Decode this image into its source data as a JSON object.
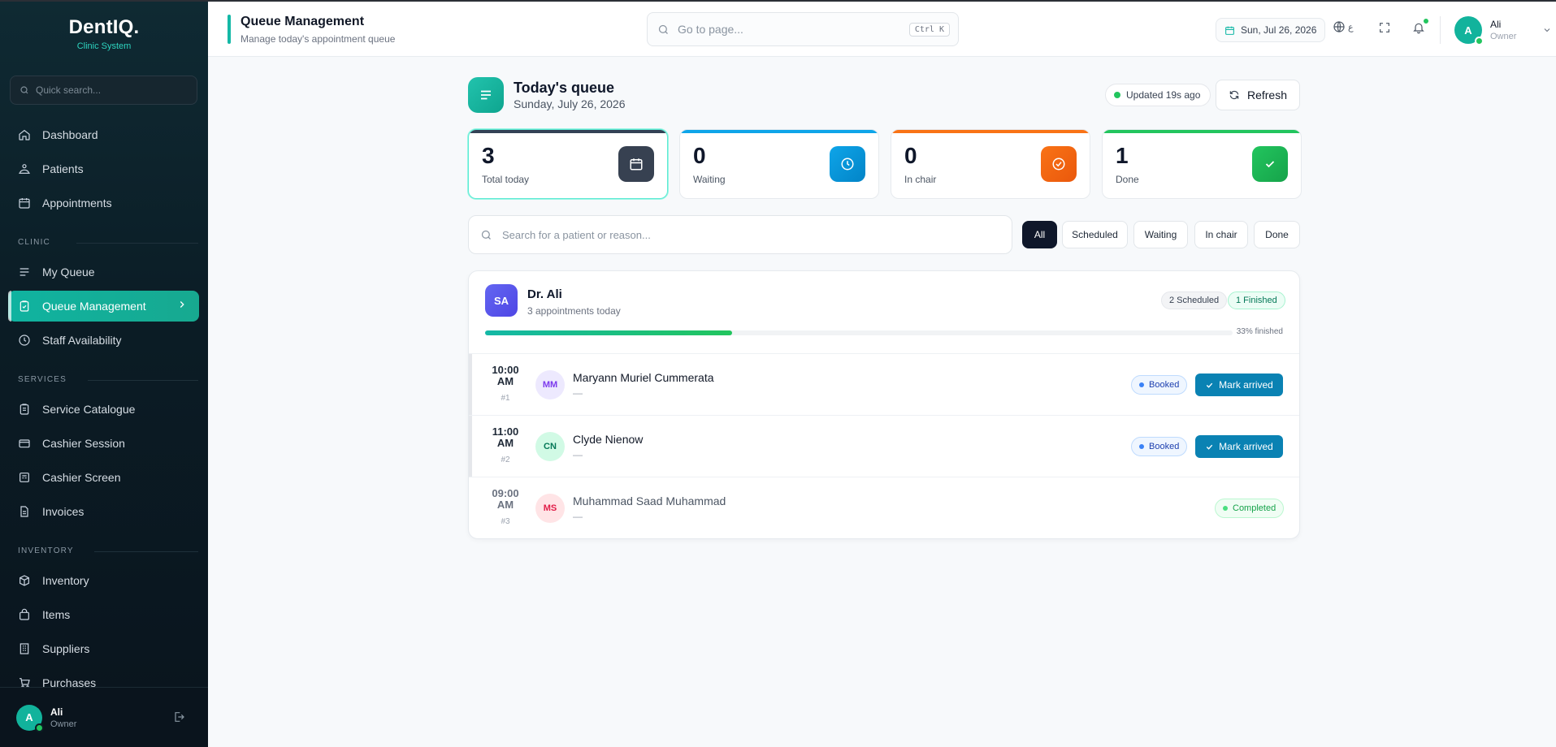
{
  "brand": {
    "name": "DentIQ.",
    "subtitle": "Clinic System"
  },
  "sidebar": {
    "search_placeholder": "Quick search...",
    "items": [
      {
        "label": "Dashboard",
        "icon": "home-icon"
      },
      {
        "label": "Patients",
        "icon": "patients-icon"
      },
      {
        "label": "Appointments",
        "icon": "calendar-icon"
      },
      {
        "label": "My Queue",
        "icon": "list-icon"
      },
      {
        "label": "Queue Management",
        "icon": "clipboard-check-icon",
        "active": true
      },
      {
        "label": "Staff Availability",
        "icon": "clock-icon"
      },
      {
        "label": "Service Catalogue",
        "icon": "clipboard-icon"
      },
      {
        "label": "Cashier Session",
        "icon": "wallet-icon"
      },
      {
        "label": "Cashier Screen",
        "icon": "register-icon"
      },
      {
        "label": "Invoices",
        "icon": "file-icon"
      },
      {
        "label": "Inventory",
        "icon": "box-icon"
      },
      {
        "label": "Items",
        "icon": "bag-icon"
      },
      {
        "label": "Suppliers",
        "icon": "building-icon"
      },
      {
        "label": "Purchases",
        "icon": "cart-icon"
      }
    ],
    "sections": {
      "clinic": "CLINIC",
      "services": "SERVICES",
      "inventory": "INVENTORY"
    },
    "user": {
      "initial": "A",
      "name": "Ali",
      "role": "Owner"
    }
  },
  "header": {
    "title": "Queue Management",
    "subtitle": "Manage today's appointment queue",
    "goto_placeholder": "Go to page...",
    "shortcut": "Ctrl K",
    "date": "Sun, Jul 26, 2026",
    "lang_glyph": "ع",
    "user": {
      "initial": "A",
      "name": "Ali",
      "role": "Owner"
    }
  },
  "main": {
    "title": "Today's queue",
    "date": "Sunday, July 26, 2026",
    "updated": "Updated 19s ago",
    "refresh_label": "Refresh",
    "stats": [
      {
        "value": "3",
        "label": "Total today",
        "color": "#334155",
        "icon": "calendar-icon"
      },
      {
        "value": "0",
        "label": "Waiting",
        "color": "#0ea5e9",
        "icon": "clock-icon"
      },
      {
        "value": "0",
        "label": "In chair",
        "color": "#f97316",
        "icon": "check-circle-icon"
      },
      {
        "value": "1",
        "label": "Done",
        "color": "#22c55e",
        "icon": "check-icon"
      }
    ],
    "search_placeholder": "Search for a patient or reason...",
    "filters": [
      "All",
      "Scheduled",
      "Waiting",
      "In chair",
      "Done"
    ],
    "doctor": {
      "initials": "SA",
      "name": "Dr. Ali",
      "subtitle": "3 appointments today",
      "badge_scheduled": "2 Scheduled",
      "badge_finished": "1 Finished",
      "progress": 0.33,
      "progress_label": "33% finished"
    },
    "appointments": [
      {
        "time_line1": "10:00",
        "time_line2": "AM",
        "index": "#1",
        "initials": "MM",
        "name": "Maryann Muriel Cummerata",
        "reason": "—",
        "status": "Booked",
        "action": "Mark arrived",
        "avatar_bg": "#ede9fe",
        "avatar_fg": "#7c3aed"
      },
      {
        "time_line1": "11:00",
        "time_line2": "AM",
        "index": "#2",
        "initials": "CN",
        "name": "Clyde Nienow",
        "reason": "—",
        "status": "Booked",
        "action": "Mark arrived",
        "avatar_bg": "#d1fae5",
        "avatar_fg": "#047857"
      },
      {
        "time_line1": "09:00",
        "time_line2": "AM",
        "index": "#3",
        "initials": "MS",
        "name": "Muhammad Saad Muhammad",
        "reason": "—",
        "status": "Completed",
        "action": "",
        "avatar_bg": "#ffe4e6",
        "avatar_fg": "#e11d48"
      }
    ]
  }
}
